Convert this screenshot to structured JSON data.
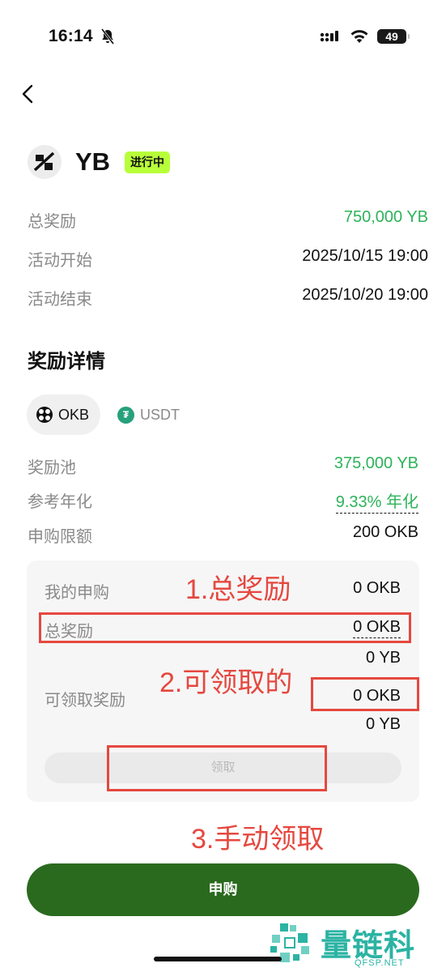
{
  "status_bar": {
    "time": "16:14",
    "battery": "49"
  },
  "header": {
    "token": "YB",
    "status_badge": "进行中"
  },
  "info": [
    {
      "label": "总奖励",
      "value": "750,000 YB"
    },
    {
      "label": "活动开始",
      "value": "2025/10/15 19:00"
    },
    {
      "label": "活动结束",
      "value": "2025/10/20 19:00"
    }
  ],
  "details": {
    "title": "奖励详情",
    "tabs": [
      {
        "label": "OKB",
        "selected": true
      },
      {
        "label": "USDT",
        "selected": false
      }
    ],
    "rows": [
      {
        "label": "奖励池",
        "value": "375,000 YB"
      },
      {
        "label": "参考年化",
        "value": "9.33% 年化"
      },
      {
        "label": "申购限额",
        "value": "200 OKB"
      }
    ]
  },
  "card": {
    "my_subscription_label": "我的申购",
    "my_subscription_value": "0 OKB",
    "total_reward_label": "总奖励",
    "total_reward_okb": "0 OKB",
    "total_reward_yb": "0 YB",
    "claimable_label": "可领取奖励",
    "claimable_okb": "0 OKB",
    "claimable_yb": "0 YB",
    "claim_button": "领取"
  },
  "annotations": {
    "a1": "1.总奖励",
    "a2": "2.可领取的",
    "a3": "3.手动领取"
  },
  "subscribe_button": "申购",
  "watermark": {
    "title": "量链科技",
    "subtitle": "QFSP.NET"
  },
  "colors": {
    "green": "#2db35a",
    "badge": "#b8ff3a",
    "primary_button": "#2a6a1e",
    "annotation": "#e5483f"
  }
}
